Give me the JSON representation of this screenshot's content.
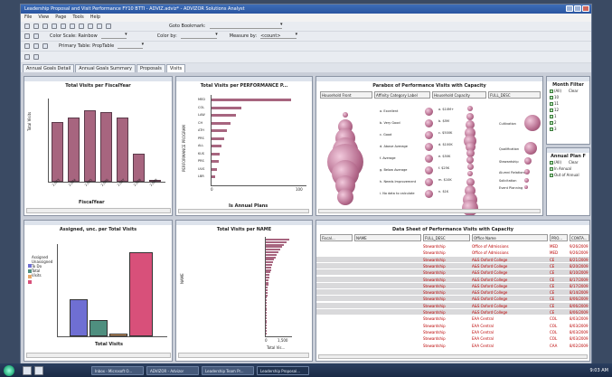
{
  "window": {
    "title": "Leadership Proposal and Visit Performance FY10 BTTI - ADVIZ.adviz* - ADVIZOR Solutions Analyst"
  },
  "menu": [
    "File",
    "View",
    "Page",
    "Tools",
    "Help"
  ],
  "toolbar1": {
    "goto_label": "Goto Bookmark:",
    "goto_value": ""
  },
  "toolbar2": {
    "color_scale_label": "Color Scale: Rainbow",
    "color_by_label": "Color by:",
    "measure_by_label": "Measure by:",
    "measure_by_value": "<count>"
  },
  "toolbar3": {
    "primary_table_label": "Primary Table: PropTable"
  },
  "tabs": [
    {
      "label": "Annual Goals Detail"
    },
    {
      "label": "Annual Goals Summary"
    },
    {
      "label": "Proposals"
    },
    {
      "label": "Visits"
    }
  ],
  "views": {
    "fiscal": {
      "title": "Total Visits per FiscalYear",
      "xlabel": "FiscalYear",
      "ylabel": "Total Visits"
    },
    "perf": {
      "title": "Total Visits per PERFORMANCE P...",
      "ylabel": "PERFORMANCE PROGRAM",
      "xlabel": "Is Annual Plans",
      "x_ticks": [
        "0",
        "100"
      ],
      "labels": [
        "MED",
        "COL",
        "LAW",
        "CH",
        "ATH",
        "PRS",
        "ALL",
        "KUS",
        "PRS",
        "UUS",
        "LBR"
      ]
    },
    "parallel": {
      "title": "Parabox of Performance Visits with Capacity",
      "headers": [
        "Household Front",
        "Affinity Category Label",
        "Household Capacity",
        "FULL_DESC"
      ],
      "affinity": [
        "a. Excellent",
        "b. Very Good",
        "c. Good",
        "d. Above Average",
        "f. Average",
        "g. Below Average",
        "h. Needs Improvement",
        "i. No data to calculate"
      ],
      "capacity": [
        "a. $10M+",
        "b. $5M",
        "c. $500K",
        "d. $100K",
        "e. $50K",
        "f. $25K",
        "m. $10K",
        "n. $1K"
      ],
      "full_desc": [
        "Cultivation",
        "Qualification",
        "Stewardship",
        "Alumni Relations",
        "Solicitation",
        "Event Planning"
      ]
    },
    "month_filter": {
      "title": "Month Filter",
      "items": [
        "(All)",
        "10",
        "11",
        "12",
        "1",
        "2",
        "3"
      ],
      "clr": "Clear"
    },
    "annual_plan": {
      "title": "Annual Plan F",
      "items": [
        "(All)",
        "In Annual",
        "Out of Annual"
      ],
      "clr": "Clear"
    },
    "assigned": {
      "title": "Assigned, unc. per Total Visits",
      "xlabel": "Total Visits",
      "legend": "Assigned\nUnassigned\nTo Do\nTotal Visits"
    },
    "name": {
      "title": "Total Visits per NAME",
      "ylabel": "NAME",
      "xlabel": "Total Vis...",
      "x_ticks": [
        "0",
        "1,500"
      ]
    },
    "datasheet": {
      "title": "Data Sheet of Performance Visits with Capacity",
      "columns": [
        "Fiscal...",
        "NAME",
        "FULL_DESC",
        "Office Name",
        "PRO...",
        "CONTA..."
      ],
      "rows": [
        [
          "",
          "",
          "Stewardship",
          "Office of Admissions",
          "MED",
          "9/26/2009"
        ],
        [
          "",
          "",
          "Stewardship",
          "Office of Admissions",
          "MED",
          "9/26/2009"
        ],
        [
          "",
          "",
          "Stewardship",
          "A&S Oxford College",
          "CE",
          "8/21/2009"
        ],
        [
          "",
          "",
          "Stewardship",
          "A&S Oxford College",
          "CE",
          "8/20/2009"
        ],
        [
          "",
          "",
          "Stewardship",
          "A&S Oxford College",
          "CE",
          "8/10/2009"
        ],
        [
          "",
          "",
          "Stewardship",
          "A&S Oxford College",
          "CE",
          "8/17/2009"
        ],
        [
          "",
          "",
          "Stewardship",
          "A&S Oxford College",
          "CE",
          "8/17/2009"
        ],
        [
          "",
          "",
          "Stewardship",
          "A&S Oxford College",
          "CE",
          "8/14/2009"
        ],
        [
          "",
          "",
          "Stewardship",
          "A&S Oxford College",
          "CE",
          "8/06/2009"
        ],
        [
          "",
          "",
          "Stewardship",
          "A&S Oxford College",
          "CE",
          "8/06/2009"
        ],
        [
          "",
          "",
          "Stewardship",
          "A&S Oxford College",
          "CE",
          "8/06/2009"
        ],
        [
          "",
          "",
          "Stewardship",
          "EAA Central",
          "COL",
          "8/03/2009"
        ],
        [
          "",
          "",
          "Stewardship",
          "EAA Central",
          "COL",
          "8/03/2009"
        ],
        [
          "",
          "",
          "Stewardship",
          "EAA Central",
          "COL",
          "8/03/2009"
        ],
        [
          "",
          "",
          "Stewardship",
          "EAA Central",
          "COL",
          "8/03/2009"
        ],
        [
          "",
          "",
          "Stewardship",
          "EAA Central",
          "CAA",
          "8/02/2009"
        ]
      ]
    }
  },
  "chart_data": [
    {
      "type": "bar",
      "title": "Total Visits per FiscalYear",
      "categories": [
        "2,003",
        "2,004",
        "2,005",
        "2,006",
        "2,007",
        "2,008",
        "2,009"
      ],
      "values": [
        60,
        65,
        72,
        70,
        65,
        28,
        2
      ],
      "xlabel": "FiscalYear",
      "ylabel": "Total Visits",
      "grid": false
    },
    {
      "type": "bar",
      "title": "Total Visits per PERFORMANCE P...",
      "orientation": "horizontal",
      "categories": [
        "MED",
        "COL",
        "LAW",
        "CH",
        "ATH",
        "PRS",
        "ALL",
        "KUS",
        "PRS",
        "UUS",
        "LBR"
      ],
      "values": [
        85,
        32,
        26,
        20,
        16,
        13,
        11,
        9,
        8,
        6,
        4
      ],
      "xlim": [
        0,
        100
      ],
      "xlabel": "Is Annual Plans",
      "ylabel": "PERFORMANCE PROGRAM"
    },
    {
      "type": "bar",
      "title": "Assigned, unc. per Total Visits",
      "categories": [
        "Assigned",
        "Unassigned",
        "To Do",
        "Total Visits"
      ],
      "values": [
        42,
        18,
        3,
        95
      ],
      "xlabel": "Total Visits",
      "colors": [
        "#6f6fd3",
        "#4f8f7f",
        "#e8a868",
        "#d8507a"
      ]
    }
  ],
  "taskbar": {
    "items": [
      "Inbox - Microsoft O...",
      "ADVIZOR - Advizor",
      "Leadership Team Pr...",
      "Leadership Proposal..."
    ],
    "clock": "9:03 AM"
  }
}
